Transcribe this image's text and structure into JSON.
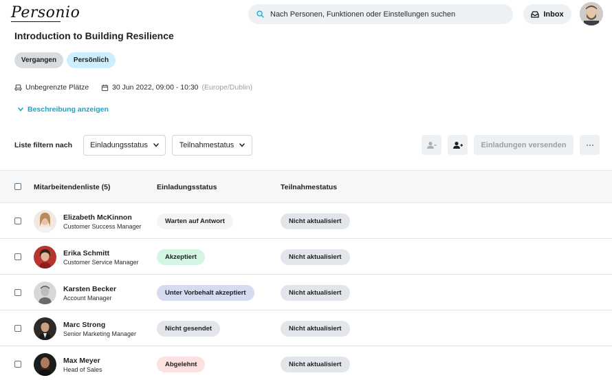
{
  "header": {
    "logo": "Personio",
    "search_placeholder": "Nach Personen, Funktionen oder Einstellungen suchen",
    "inbox_label": "Inbox"
  },
  "event": {
    "title": "Introduction to Building Resilience",
    "chips": [
      "Vergangen",
      "Persönlich"
    ],
    "seats": "Unbegrenzte Plätze",
    "datetime": "30 Jun 2022, 09:00 - 10:30",
    "timezone": "(Europe/Dublin)",
    "show_description": "Beschreibung anzeigen"
  },
  "filters": {
    "label": "Liste filtern nach",
    "invite_status": "Einladungsstatus",
    "attendance_status": "Teilnahmestatus",
    "send_invites": "Einladungen versenden"
  },
  "table": {
    "col_employees": "Mitarbeitendenliste (5)",
    "col_invite": "Einladungsstatus",
    "col_attend": "Teilnahmestatus",
    "rows": [
      {
        "name": "Elizabeth McKinnon",
        "role": "Customer Success Manager",
        "invite": "Warten auf Antwort",
        "invite_color": "#f3f4f5",
        "attend": "Nicht aktualisiert"
      },
      {
        "name": "Erika Schmitt",
        "role": "Customer Service Manager",
        "invite": "Akzeptiert",
        "invite_color": "#d4f5e3",
        "attend": "Nicht aktualisiert"
      },
      {
        "name": "Karsten Becker",
        "role": "Account Manager",
        "invite": "Unter Vorbehalt akzeptiert",
        "invite_color": "#d6dcef",
        "attend": "Nicht aktualisiert"
      },
      {
        "name": "Marc Strong",
        "role": "Senior Marketing Manager",
        "invite": "Nicht gesendet",
        "invite_color": "#e2e6ea",
        "attend": "Nicht aktualisiert"
      },
      {
        "name": "Max Meyer",
        "role": "Head of Sales",
        "invite": "Abgelehnt",
        "invite_color": "#fde1e1",
        "attend": "Nicht aktualisiert"
      }
    ]
  },
  "colors": {
    "accent": "#1aa3c8",
    "attend_badge": "#e2e6ea"
  }
}
